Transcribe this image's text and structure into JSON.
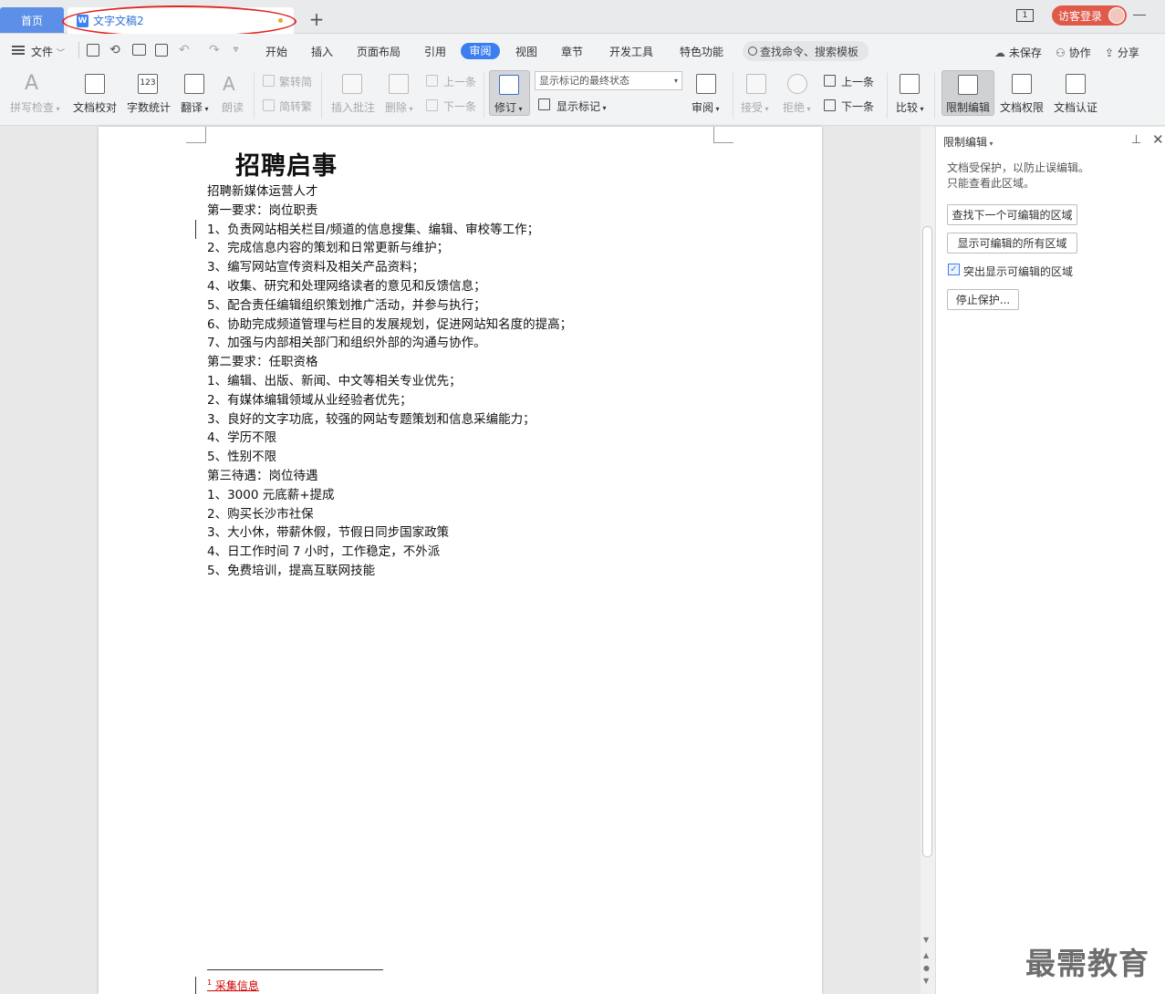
{
  "tabs": {
    "home": "首页",
    "doc": "文字文稿2",
    "add": "+"
  },
  "window": {
    "badge": "1",
    "login": "访客登录"
  },
  "menu": {
    "file": "文件",
    "items": [
      "开始",
      "插入",
      "页面布局",
      "引用",
      "审阅",
      "视图",
      "章节",
      "开发工具",
      "特色功能"
    ],
    "active": "审阅",
    "search": "查找命令、搜索模板",
    "unsaved": "未保存",
    "collab": "协作",
    "share": "分享"
  },
  "ribbon": {
    "spell": "拼写检查",
    "proof": "文档校对",
    "wordcount": "字数统计",
    "translate": "翻译",
    "read": "朗读",
    "trad2simp": "繁转简",
    "simp2trad": "简转繁",
    "insert_comment": "插入批注",
    "delete": "删除",
    "prev1": "上一条",
    "next1": "下一条",
    "revise": "修订",
    "markup_state": "显示标记的最终状态",
    "show_markup": "显示标记",
    "review": "审阅",
    "accept": "接受",
    "reject": "拒绝",
    "prev2": "上一条",
    "next2": "下一条",
    "compare": "比较",
    "restrict": "限制编辑",
    "permission": "文档权限",
    "certify": "文档认证"
  },
  "document": {
    "title": "招聘启事",
    "lines": [
      "招聘新媒体运营人才",
      "第一要求：岗位职责",
      "1、负责网站相关栏目/频道的信息搜集、编辑、审校等工作；",
      "2、完成信息内容的策划和日常更新与维护；",
      "3、编写网站宣传资料及相关产品资料；",
      "4、收集、研究和处理网络读者的意见和反馈信息；",
      "5、配合责任编辑组织策划推广活动，并参与执行；",
      "6、协助完成频道管理与栏目的发展规划，促进网站知名度的提高；",
      "7、加强与内部相关部门和组织外部的沟通与协作。",
      "第二要求：任职资格",
      "1、编辑、出版、新闻、中文等相关专业优先；",
      "2、有媒体编辑领域从业经验者优先；",
      "3、良好的文字功底，较强的网站专题策划和信息采编能力；",
      "4、学历不限",
      "5、性别不限",
      "第三待遇：岗位待遇",
      "1、3000 元底薪+提成",
      "2、购买长沙市社保",
      "3、大小休，带薪休假，节假日同步国家政策",
      "4、日工作时间 7 小时，工作稳定，不外派",
      "5、免费培训，提高互联网技能"
    ],
    "footnote_mark": "1",
    "footnote": "采集信息"
  },
  "panel": {
    "title": "限制编辑",
    "desc1": "文档受保护，以防止误编辑。",
    "desc2": "只能查看此区域。",
    "find_next": "查找下一个可编辑的区域",
    "show_all": "显示可编辑的所有区域",
    "highlight": "突出显示可编辑的区域",
    "highlight_checked": true,
    "stop": "停止保护..."
  },
  "watermark": "最需教育",
  "colors": {
    "accent": "#3b7ef0",
    "home_tab": "#5b8fe8",
    "login": "#e05a4a",
    "annotation": "#e0241f"
  }
}
